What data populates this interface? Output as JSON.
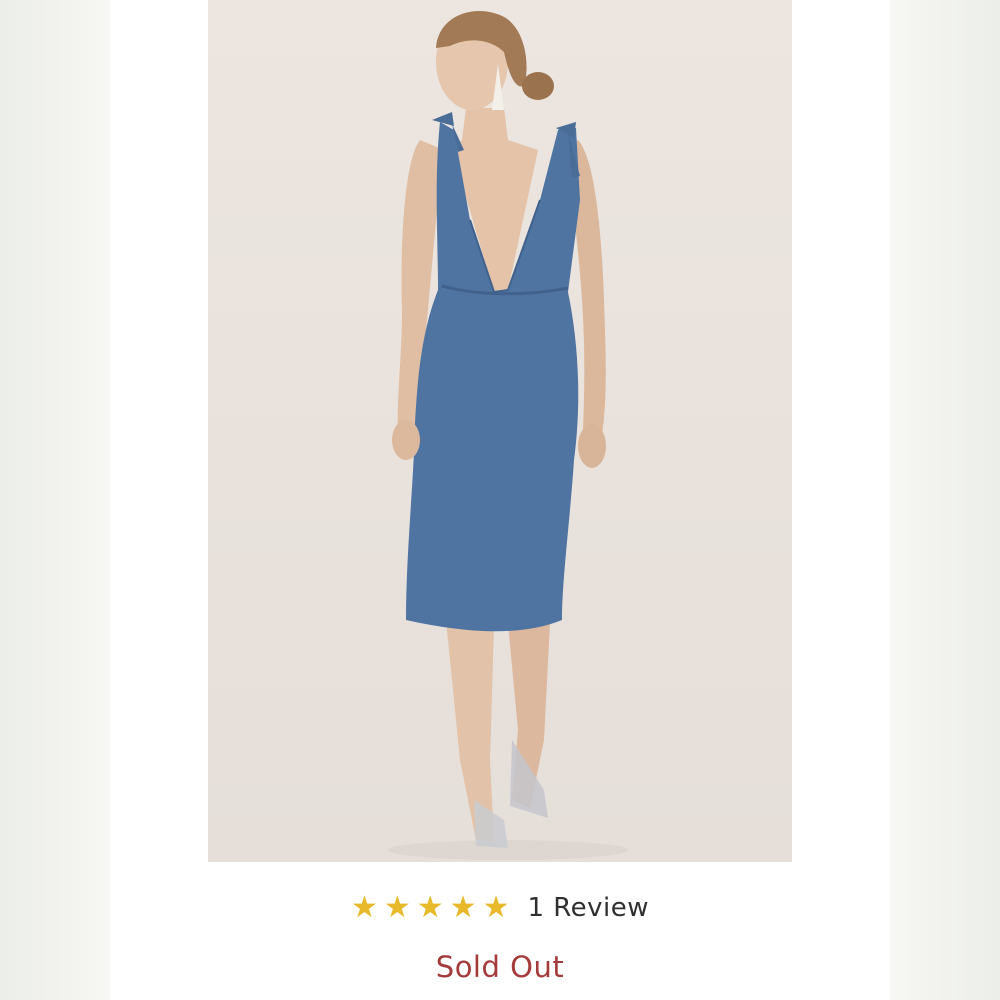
{
  "product": {
    "image_alt": "",
    "rating": {
      "stars_filled": 5,
      "stars_total": 5,
      "review_label": "1 Review",
      "star_color": "#e8b92b"
    },
    "availability": {
      "status_text": "Sold Out",
      "status_color": "#a53a3a"
    },
    "colors": {
      "dress": "#4f74a2",
      "backdrop": "#ebe4de"
    }
  }
}
